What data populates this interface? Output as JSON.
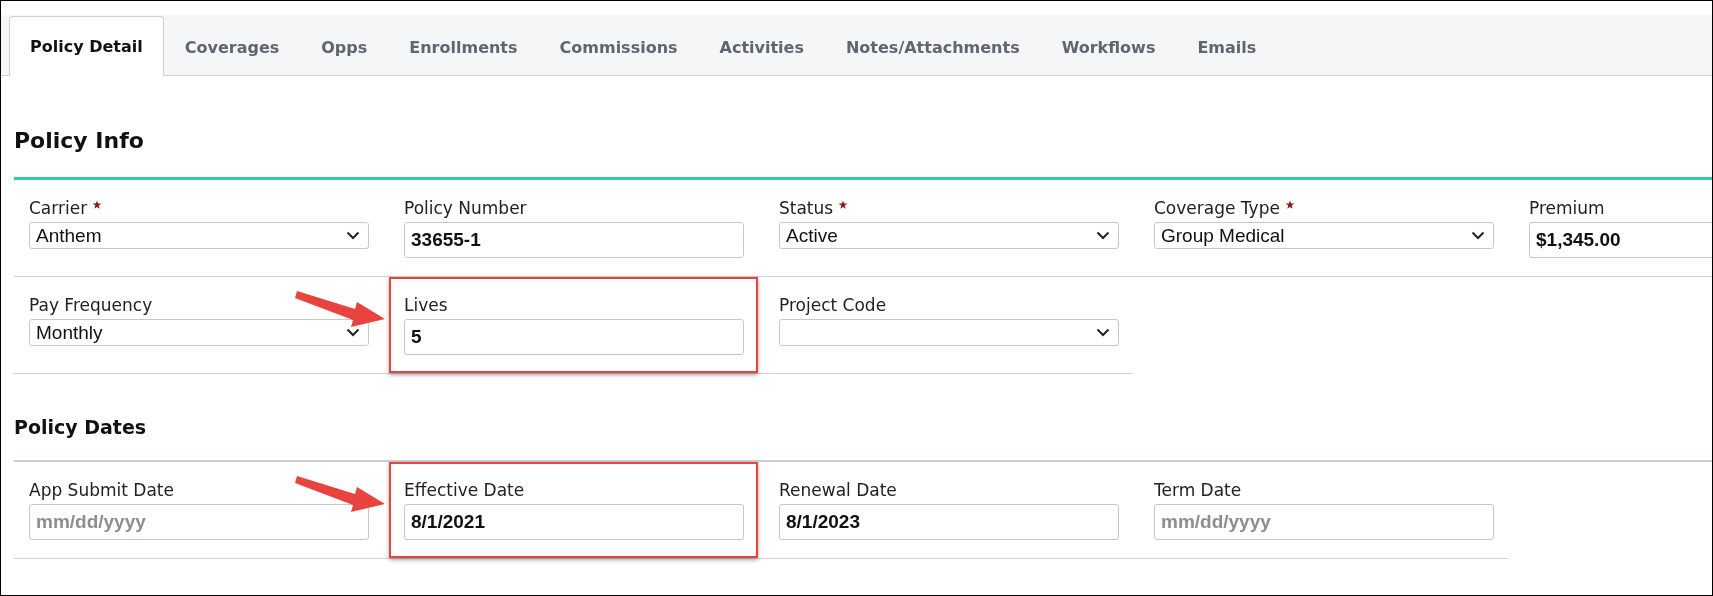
{
  "tabs": [
    {
      "label": "Policy Detail",
      "selected": true
    },
    {
      "label": "Coverages",
      "selected": false
    },
    {
      "label": "Opps",
      "selected": false
    },
    {
      "label": "Enrollments",
      "selected": false
    },
    {
      "label": "Commissions",
      "selected": false
    },
    {
      "label": "Activities",
      "selected": false
    },
    {
      "label": "Notes/Attachments",
      "selected": false
    },
    {
      "label": "Workflows",
      "selected": false
    },
    {
      "label": "Emails",
      "selected": false
    }
  ],
  "sections": [
    {
      "title": "Policy Info",
      "kind": "primary",
      "rows": [
        [
          {
            "label": "Carrier",
            "required": true,
            "kind": "select",
            "value": "Anthem",
            "highlighted": false
          },
          {
            "label": "Policy Number",
            "required": false,
            "kind": "input",
            "value": "33655-1",
            "highlighted": false
          },
          {
            "label": "Status",
            "required": true,
            "kind": "select",
            "value": "Active",
            "highlighted": false
          },
          {
            "label": "Coverage Type",
            "required": true,
            "kind": "select",
            "value": "Group Medical",
            "highlighted": false
          },
          {
            "label": "Premium",
            "required": false,
            "kind": "input",
            "value": "$1,345.00",
            "highlighted": false
          }
        ],
        [
          {
            "label": "Pay Frequency",
            "required": false,
            "kind": "select",
            "value": "Monthly",
            "highlighted": false
          },
          {
            "label": "Lives",
            "required": false,
            "kind": "input",
            "value": "5",
            "highlighted": true
          },
          {
            "label": "Project Code",
            "required": false,
            "kind": "select",
            "highlighted": false
          }
        ]
      ]
    },
    {
      "title": "Policy Dates",
      "kind": "secondary",
      "rows": [
        [
          {
            "label": "App Submit Date",
            "required": false,
            "kind": "input",
            "placeholder": "mm/dd/yyyy",
            "highlighted": false
          },
          {
            "label": "Effective Date",
            "required": false,
            "kind": "input",
            "value": "8/1/2021",
            "highlighted": true
          },
          {
            "label": "Renewal Date",
            "required": false,
            "kind": "input",
            "value": "8/1/2023",
            "highlighted": false
          },
          {
            "label": "Term Date",
            "required": false,
            "kind": "input",
            "placeholder": "mm/dd/yyyy",
            "highlighted": false
          }
        ]
      ]
    }
  ]
}
